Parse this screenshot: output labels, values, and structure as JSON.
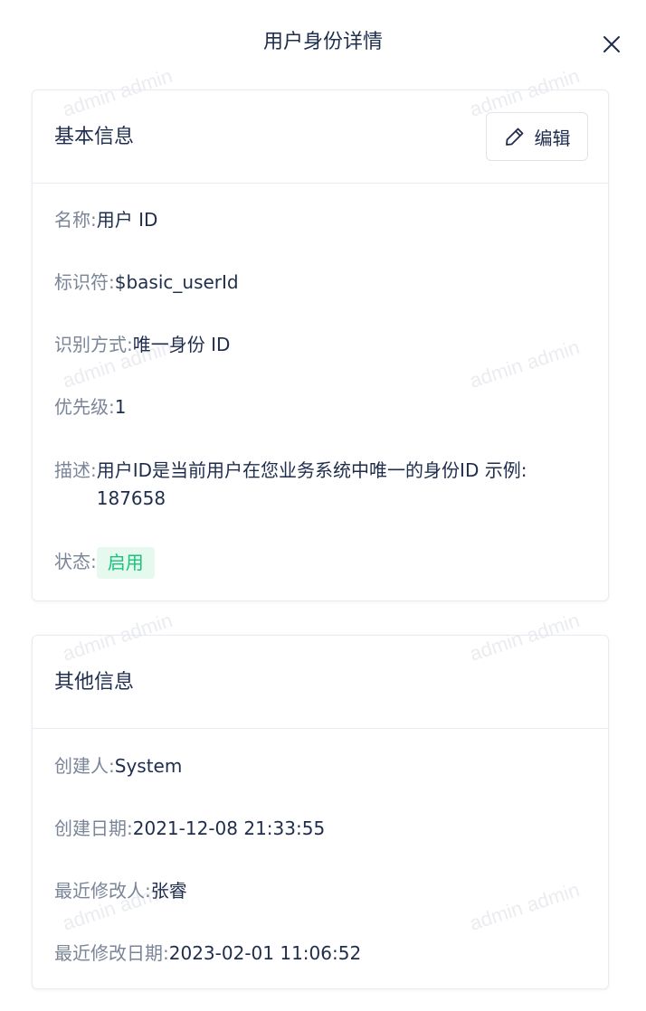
{
  "drawer": {
    "title": "用户身份详情"
  },
  "basic_info": {
    "title": "基本信息",
    "edit_label": "编辑",
    "fields": {
      "name": {
        "label": "名称:",
        "value": "用户 ID"
      },
      "identifier": {
        "label": "标识符:",
        "value": "$basic_userId"
      },
      "recognition": {
        "label": "识别方式:",
        "value": "唯一身份 ID"
      },
      "priority": {
        "label": "优先级:",
        "value": "1"
      },
      "description": {
        "label": "描述:",
        "value": "用户ID是当前用户在您业务系统中唯一的身份ID 示例: 187658"
      },
      "status": {
        "label": "状态:",
        "value": "启用"
      }
    }
  },
  "other_info": {
    "title": "其他信息",
    "fields": {
      "creator": {
        "label": "创建人:",
        "value": "System"
      },
      "created_date": {
        "label": "创建日期:",
        "value": "2021-12-08 21:33:55"
      },
      "modifier": {
        "label": "最近修改人:",
        "value": "张睿"
      },
      "modified_date": {
        "label": "最近修改日期:",
        "value": "2023-02-01 11:06:52"
      }
    }
  },
  "watermark": {
    "text": "admin admin"
  },
  "colors": {
    "text_primary": "#1f2d4d",
    "text_label": "#7a8598",
    "border": "#e8ebf1",
    "status_enabled_bg": "#e6f9ef",
    "status_enabled_text": "#19c37d"
  },
  "icons": {
    "close": "close-icon",
    "edit": "pencil-icon"
  }
}
